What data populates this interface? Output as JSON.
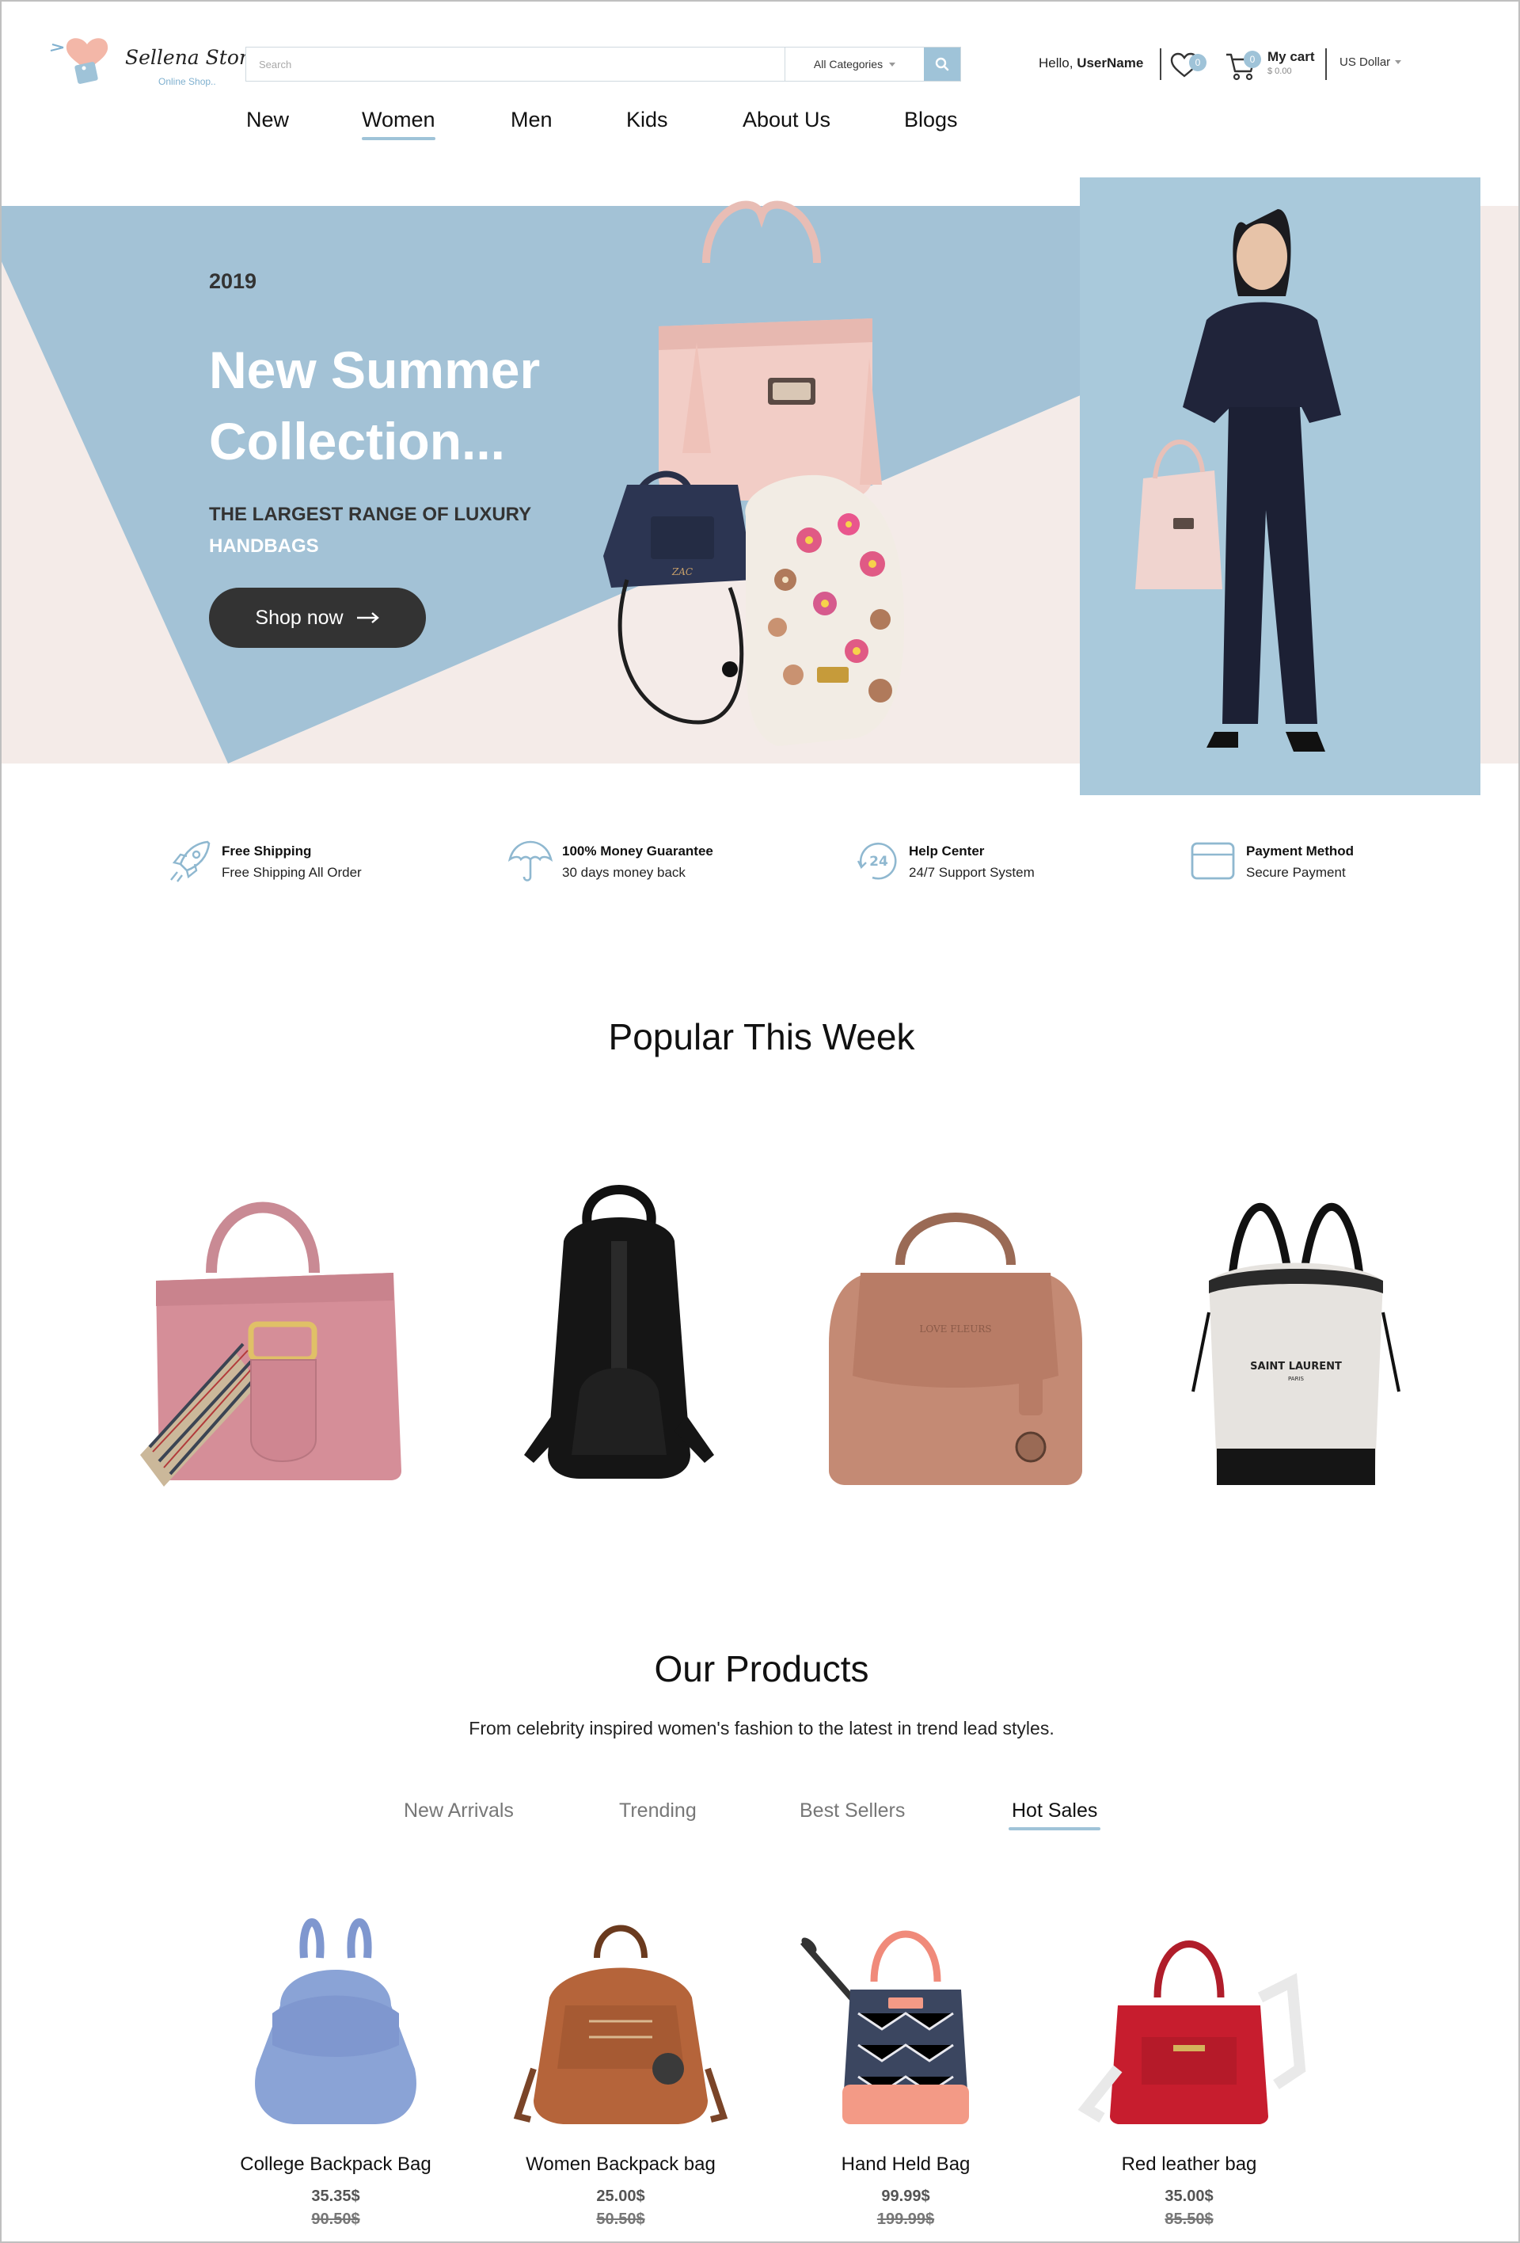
{
  "header": {
    "logo_name": "Sellena Store",
    "logo_tagline": "Online Shop..",
    "search_placeholder": "Search",
    "category_select": "All Categories",
    "greeting": "Hello,",
    "username": "UserName",
    "wishlist_count": "0",
    "cart_count": "0",
    "cart_label": "My cart",
    "cart_total": "$ 0.00",
    "currency": "US Dollar"
  },
  "nav": {
    "items": [
      "New",
      "Women",
      "Men",
      "Kids",
      "About Us",
      "Blogs"
    ],
    "active": "Women"
  },
  "hero": {
    "year": "2019",
    "title": "New Summer Collection...",
    "subtitle_dark": "THE LARGEST RANGE OF LUXURY",
    "subtitle_light": "HANDBAGS",
    "cta": "Shop now"
  },
  "features": [
    {
      "icon": "rocket-icon",
      "title": "Free Shipping",
      "subtitle": "Free Shipping All Order"
    },
    {
      "icon": "umbrella-icon",
      "title": "100% Money Guarantee",
      "subtitle": "30 days money back"
    },
    {
      "icon": "support-24-icon",
      "title": "Help Center",
      "subtitle": "24/7 Support System"
    },
    {
      "icon": "credit-card-icon",
      "title": "Payment Method",
      "subtitle": "Secure Payment"
    }
  ],
  "popular": {
    "title": "Popular This Week",
    "items": [
      "pink-tote-bag",
      "black-backpack",
      "tan-satchel-bag",
      "canvas-bucket-bag"
    ]
  },
  "products": {
    "title": "Our Products",
    "subtitle": "From celebrity inspired women's fashion to the latest in trend lead styles.",
    "tabs": [
      "New Arrivals",
      "Trending",
      "Best Sellers",
      "Hot Sales"
    ],
    "active_tab": "Hot Sales",
    "items": [
      {
        "name": "College Backpack Bag",
        "price": "35.35$",
        "old_price": "90.50$"
      },
      {
        "name": "Women Backpack bag",
        "price": "25.00$",
        "old_price": "50.50$"
      },
      {
        "name": "Hand Held Bag",
        "price": "99.99$",
        "old_price": "199.99$"
      },
      {
        "name": "Red leather bag",
        "price": "35.00$",
        "old_price": "85.50$"
      }
    ]
  },
  "colors": {
    "accent": "#9fc3d8",
    "hero_blue": "#a3c2d6",
    "hero_pink": "#f4ebe8",
    "dark_button": "#333333"
  }
}
